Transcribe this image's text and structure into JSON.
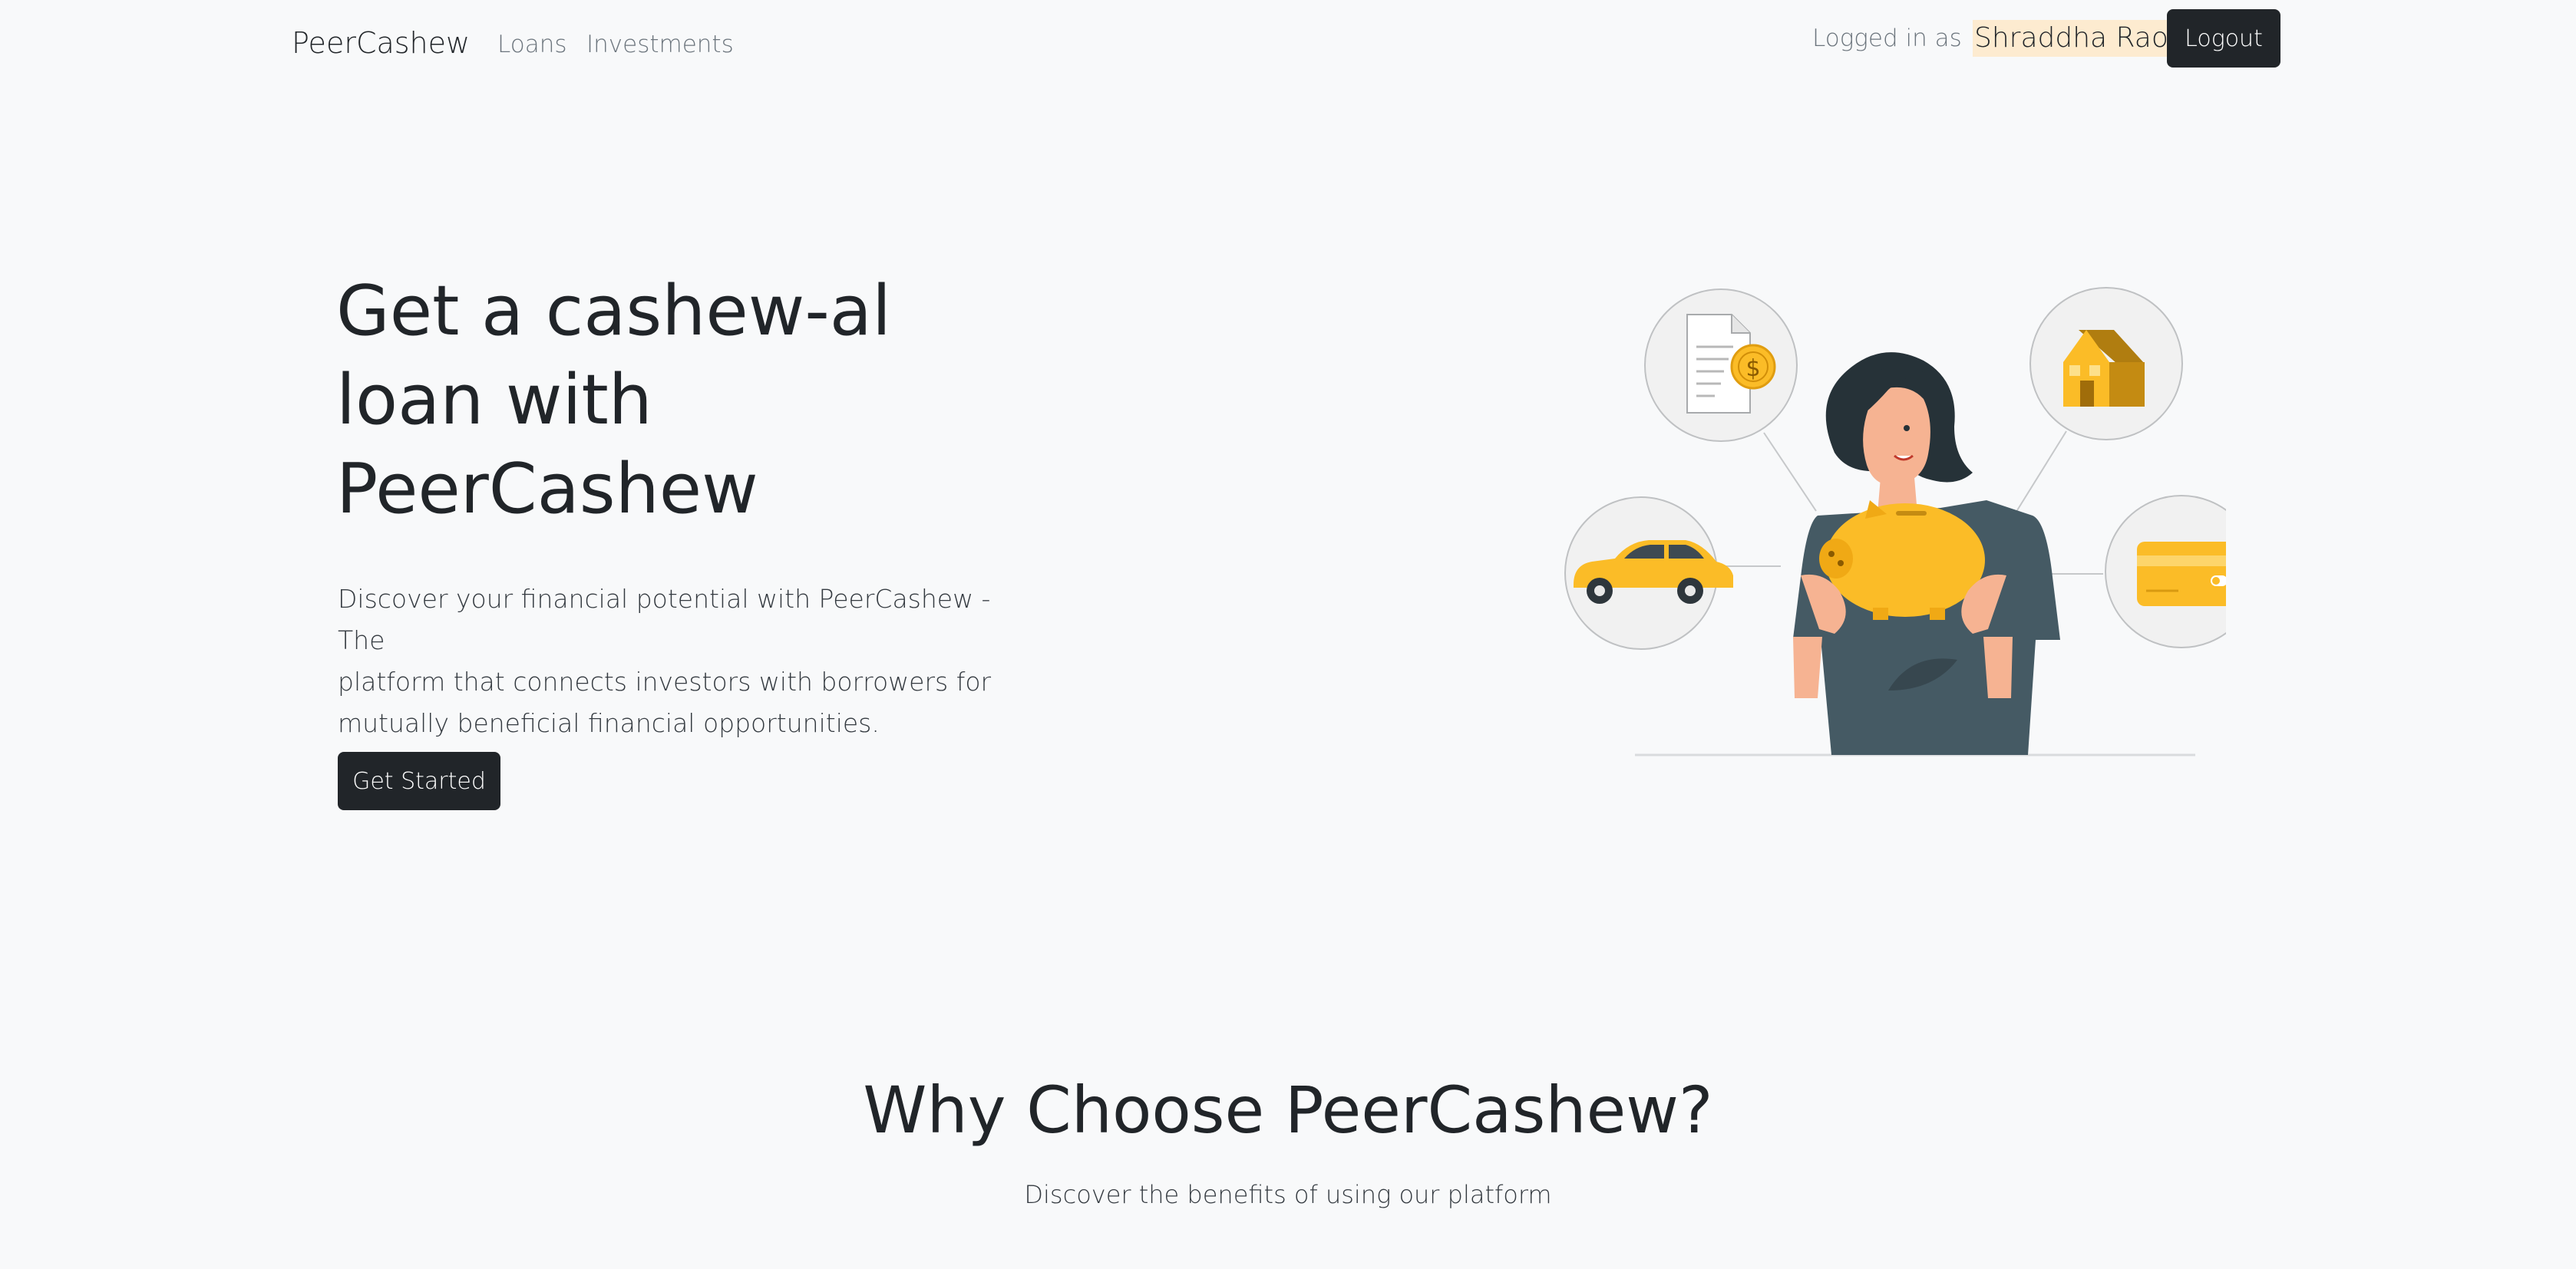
{
  "navbar": {
    "brand": "PeerCashew",
    "links": [
      {
        "label": "Loans"
      },
      {
        "label": "Investments"
      }
    ],
    "logged_in_label": "Logged in as",
    "user_name": "Shraddha Rao",
    "logout_label": "Logout"
  },
  "hero": {
    "title_lines": [
      "Get a cashew-al",
      "loan with",
      "PeerCashew"
    ],
    "lead_lines": [
      "Discover your financial potential with PeerCashew - The",
      "platform that connects investors with borrowers for",
      "mutually beneficial financial opportunities."
    ],
    "cta_label": "Get Started",
    "illustration": {
      "icons": [
        "document-dollar-icon",
        "house-icon",
        "car-icon",
        "credit-card-icon",
        "piggy-bank-icon"
      ],
      "accent_color": "#fbbc27"
    }
  },
  "why": {
    "title": "Why Choose PeerCashew?",
    "subtitle": "Discover the benefits of using our platform"
  },
  "colors": {
    "background": "#f8f9fa",
    "dark_button": "#212529",
    "user_highlight": "#fdebd0",
    "accent": "#fbbc27"
  }
}
